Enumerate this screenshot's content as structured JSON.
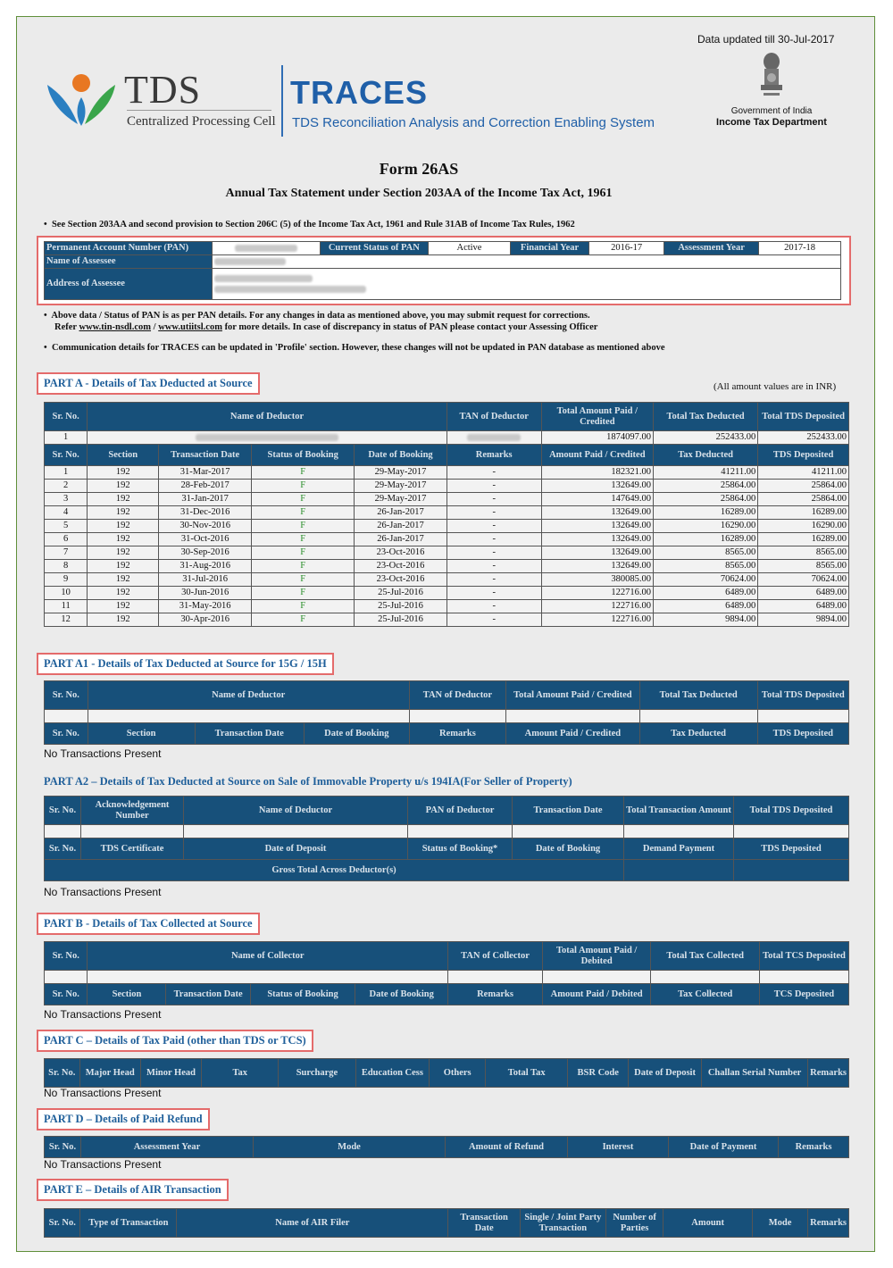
{
  "header": {
    "updated": "Data updated till 30-Jul-2017",
    "tds": "TDS",
    "cpc": "Centralized Processing Cell",
    "traces": "TRACES",
    "traces_sub": "TDS Reconciliation Analysis and Correction Enabling System",
    "goi": "Government of India",
    "itd": "Income Tax Department"
  },
  "title": {
    "form": "Form 26AS",
    "subtitle": "Annual Tax Statement under Section 203AA of the Income Tax Act, 1961",
    "note1": "See Section 203AA and second provision to Section 206C (5) of the Income Tax Act, 1961 and Rule 31AB of Income Tax Rules, 1962"
  },
  "pan": {
    "pan_label": "Permanent Account Number (PAN)",
    "status_label": "Current Status of PAN",
    "status_value": "Active",
    "fy_label": "Financial Year",
    "fy_value": "2016-17",
    "ay_label": "Assessment Year",
    "ay_value": "2017-18",
    "name_label": "Name of Assessee",
    "address_label": "Address of Assessee"
  },
  "notes": {
    "n2a": "Above data / Status of PAN is as per PAN details. For any changes in data as mentioned above, you may submit request for corrections.",
    "n2b_pre": "Refer",
    "n2b_link1": "www.tin-nsdl.com",
    "n2b_sep": "/",
    "n2b_link2": "www.utiitsl.com",
    "n2b_post": "for more details. In case of discrepancy in status of PAN please contact your Assessing Officer",
    "n3": "Communication details for TRACES can be updated in 'Profile' section. However, these changes will not be updated in PAN database as mentioned above"
  },
  "partA": {
    "title": "PART A - Details of Tax Deducted at Source",
    "inr": "(All amount values are in INR)",
    "h_sr": "Sr. No.",
    "h_name": "Name of Deductor",
    "h_tan": "TAN of Deductor",
    "h_total_paid": "Total Amount Paid / Credited",
    "h_total_tax": "Total Tax Deducted",
    "h_total_tds": "Total TDS Deposited",
    "summary": {
      "sr": "1",
      "paid": "1874097.00",
      "tax": "252433.00",
      "tds": "252433.00"
    },
    "h2_sr": "Sr. No.",
    "h2_section": "Section",
    "h2_date": "Transaction Date",
    "h2_status": "Status of Booking",
    "h2_booking": "Date of Booking",
    "h2_remarks": "Remarks",
    "h2_paid": "Amount Paid / Credited",
    "h2_tax": "Tax Deducted",
    "h2_tds": "TDS Deposited",
    "rows": [
      {
        "sr": "1",
        "section": "192",
        "date": "31-Mar-2017",
        "status": "F",
        "booking": "29-May-2017",
        "remarks": "-",
        "paid": "182321.00",
        "tax": "41211.00",
        "tds": "41211.00"
      },
      {
        "sr": "2",
        "section": "192",
        "date": "28-Feb-2017",
        "status": "F",
        "booking": "29-May-2017",
        "remarks": "-",
        "paid": "132649.00",
        "tax": "25864.00",
        "tds": "25864.00"
      },
      {
        "sr": "3",
        "section": "192",
        "date": "31-Jan-2017",
        "status": "F",
        "booking": "29-May-2017",
        "remarks": "-",
        "paid": "147649.00",
        "tax": "25864.00",
        "tds": "25864.00"
      },
      {
        "sr": "4",
        "section": "192",
        "date": "31-Dec-2016",
        "status": "F",
        "booking": "26-Jan-2017",
        "remarks": "-",
        "paid": "132649.00",
        "tax": "16289.00",
        "tds": "16289.00"
      },
      {
        "sr": "5",
        "section": "192",
        "date": "30-Nov-2016",
        "status": "F",
        "booking": "26-Jan-2017",
        "remarks": "-",
        "paid": "132649.00",
        "tax": "16290.00",
        "tds": "16290.00"
      },
      {
        "sr": "6",
        "section": "192",
        "date": "31-Oct-2016",
        "status": "F",
        "booking": "26-Jan-2017",
        "remarks": "-",
        "paid": "132649.00",
        "tax": "16289.00",
        "tds": "16289.00"
      },
      {
        "sr": "7",
        "section": "192",
        "date": "30-Sep-2016",
        "status": "F",
        "booking": "23-Oct-2016",
        "remarks": "-",
        "paid": "132649.00",
        "tax": "8565.00",
        "tds": "8565.00"
      },
      {
        "sr": "8",
        "section": "192",
        "date": "31-Aug-2016",
        "status": "F",
        "booking": "23-Oct-2016",
        "remarks": "-",
        "paid": "132649.00",
        "tax": "8565.00",
        "tds": "8565.00"
      },
      {
        "sr": "9",
        "section": "192",
        "date": "31-Jul-2016",
        "status": "F",
        "booking": "23-Oct-2016",
        "remarks": "-",
        "paid": "380085.00",
        "tax": "70624.00",
        "tds": "70624.00"
      },
      {
        "sr": "10",
        "section": "192",
        "date": "30-Jun-2016",
        "status": "F",
        "booking": "25-Jul-2016",
        "remarks": "-",
        "paid": "122716.00",
        "tax": "6489.00",
        "tds": "6489.00"
      },
      {
        "sr": "11",
        "section": "192",
        "date": "31-May-2016",
        "status": "F",
        "booking": "25-Jul-2016",
        "remarks": "-",
        "paid": "122716.00",
        "tax": "6489.00",
        "tds": "6489.00"
      },
      {
        "sr": "12",
        "section": "192",
        "date": "30-Apr-2016",
        "status": "F",
        "booking": "25-Jul-2016",
        "remarks": "-",
        "paid": "122716.00",
        "tax": "9894.00",
        "tds": "9894.00"
      }
    ]
  },
  "partA1": {
    "title": "PART A1 - Details of Tax Deducted at Source for 15G / 15H",
    "h_sr": "Sr. No.",
    "h_name": "Name of Deductor",
    "h_tan": "TAN of Deductor",
    "h_total_paid": "Total Amount Paid / Credited",
    "h_total_tax": "Total Tax Deducted",
    "h_total_tds": "Total TDS Deposited",
    "h2_sr": "Sr. No.",
    "h2_section": "Section",
    "h2_date": "Transaction Date",
    "h2_booking": "Date of Booking",
    "h2_remarks": "Remarks",
    "h2_paid": "Amount Paid / Credited",
    "h2_tax": "Tax Deducted",
    "h2_tds": "TDS Deposited",
    "none": "No Transactions Present"
  },
  "partA2": {
    "title": "PART A2 – Details of Tax Deducted at Source on Sale of Immovable Property u/s 194IA(For Seller of Property)",
    "h_sr": "Sr. No.",
    "h_ack": "Acknowledgement Number",
    "h_name": "Name of Deductor",
    "h_pan": "PAN of  Deductor",
    "h_date": "Transaction Date",
    "h_amount": "Total Transaction Amount",
    "h_tds": "Total TDS Deposited",
    "h2_sr": "Sr. No.",
    "h2_cert": "TDS Certificate",
    "h2_deposit": "Date of Deposit",
    "h2_status": "Status of Booking*",
    "h2_booking": "Date of Booking",
    "h2_demand": "Demand Payment",
    "h2_tds": "TDS Deposited",
    "gross": "Gross Total Across Deductor(s)",
    "none": "No Transactions Present"
  },
  "partB": {
    "title": "PART B - Details of Tax Collected at Source",
    "h_sr": "Sr. No.",
    "h_name": "Name of Collector",
    "h_tan": "TAN of Collector",
    "h_total_paid": "Total Amount Paid / Debited",
    "h_total_tax": "Total Tax Collected",
    "h_total_tcs": "Total TCS Deposited",
    "h2_sr": "Sr. No.",
    "h2_section": "Section",
    "h2_date": "Transaction Date",
    "h2_status": "Status of Booking",
    "h2_booking": "Date of Booking",
    "h2_remarks": "Remarks",
    "h2_paid": "Amount Paid / Debited",
    "h2_tax": "Tax Collected",
    "h2_tcs": "TCS Deposited",
    "none": "No Transactions Present"
  },
  "partC": {
    "title": "PART C – Details of Tax Paid (other than TDS or TCS)",
    "cols": [
      "Sr. No.",
      "Major Head",
      "Minor Head",
      "Tax",
      "Surcharge",
      "Education Cess",
      "Others",
      "Total Tax",
      "BSR Code",
      "Date of Deposit",
      "Challan Serial Number",
      "Remarks"
    ],
    "none": "No Transactions Present"
  },
  "partD": {
    "title": "PART D  – Details of Paid Refund",
    "cols": [
      "Sr. No.",
      "Assessment Year",
      "Mode",
      "Amount of Refund",
      "Interest",
      "Date of Payment",
      "Remarks"
    ],
    "none": "No Transactions Present"
  },
  "partE": {
    "title": "PART E – Details of AIR Transaction",
    "cols": [
      "Sr. No.",
      "Type of Transaction",
      "Name of AIR Filer",
      "Transaction Date",
      "Single / Joint Party Transaction",
      "Number of Parties",
      "Amount",
      "Mode",
      "Remarks"
    ]
  }
}
